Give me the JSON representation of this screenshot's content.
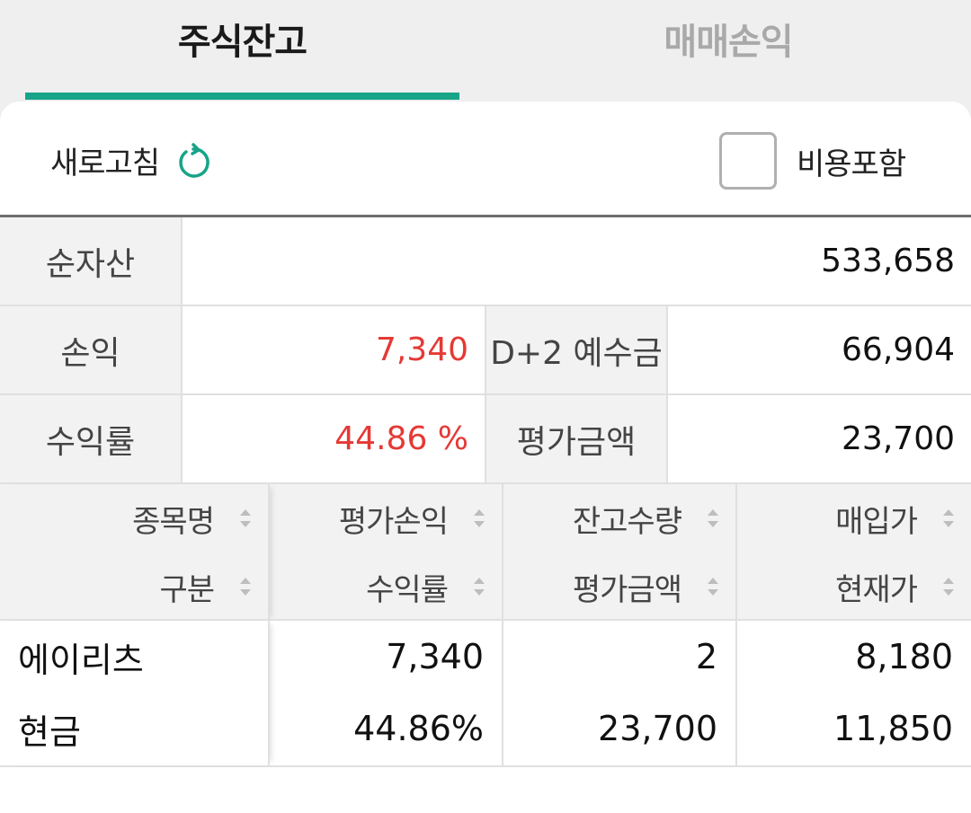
{
  "tabs": [
    {
      "label": "주식잔고",
      "active": true
    },
    {
      "label": "매매손익",
      "active": false
    }
  ],
  "toolbar": {
    "refresh_label": "새로고침",
    "include_fee_label": "비용포함",
    "include_fee_checked": false
  },
  "summary": {
    "net_assets": {
      "label": "순자산",
      "value": "533,658"
    },
    "profit": {
      "label": "손익",
      "value": "7,340"
    },
    "deposit_d2": {
      "label": "D+2 예수금",
      "value": "66,904"
    },
    "return_rate": {
      "label": "수익률",
      "value": "44.86 %"
    },
    "eval_amount": {
      "label": "평가금액",
      "value": "23,700"
    }
  },
  "table": {
    "headers": [
      {
        "top": "종목명",
        "bottom": "구분"
      },
      {
        "top": "평가손익",
        "bottom": "수익률"
      },
      {
        "top": "잔고수량",
        "bottom": "평가금액"
      },
      {
        "top": "매입가",
        "bottom": "현재가"
      }
    ],
    "rows": [
      {
        "name": "에이리츠",
        "type": "현금",
        "eval_profit": "7,340",
        "return_rate": "44.86%",
        "quantity": "2",
        "eval_amount": "23,700",
        "buy_price": "8,180",
        "current_price": "11,850"
      }
    ]
  },
  "colors": {
    "accent": "#17a488",
    "positive": "#e53935",
    "price_up_blue": "#2f7fe0"
  }
}
